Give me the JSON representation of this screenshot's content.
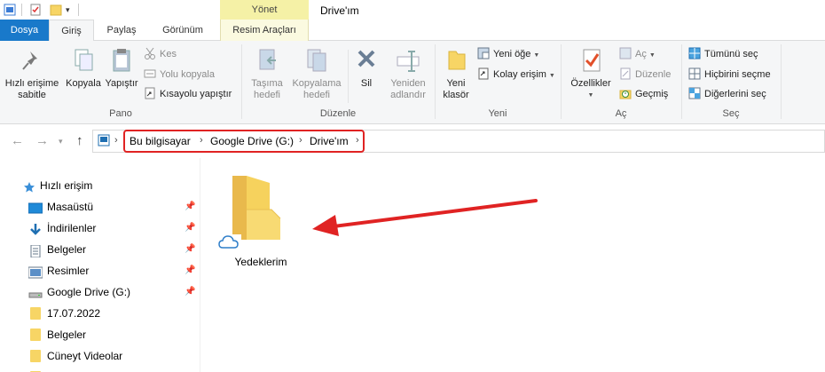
{
  "title_bar": {
    "window_title": "Drive'ım",
    "tool_tab_header": "Yönet"
  },
  "tabs": [
    {
      "label": "Dosya"
    },
    {
      "label": "Giriş"
    },
    {
      "label": "Paylaş"
    },
    {
      "label": "Görünüm"
    },
    {
      "label": "Resim Araçları"
    }
  ],
  "ribbon": {
    "pano": {
      "label": "Pano",
      "pin_quick_access": "Hızlı erişime\nsabitle",
      "copy": "Kopyala",
      "paste": "Yapıştır",
      "cut": "Kes",
      "copy_path": "Yolu kopyala",
      "paste_shortcut": "Kısayolu yapıştır"
    },
    "duzenle": {
      "label": "Düzenle",
      "move_to": "Taşıma\nhedefi",
      "copy_to": "Kopyalama\nhedefi",
      "delete": "Sil",
      "rename": "Yeniden\nadlandır"
    },
    "yeni": {
      "label": "Yeni",
      "new_folder": "Yeni\nklasör",
      "new_item": "Yeni öğe",
      "easy_access": "Kolay erişim"
    },
    "ac": {
      "label": "Aç",
      "properties": "Özellikler",
      "open": "Aç",
      "edit": "Düzenle",
      "history": "Geçmiş"
    },
    "sec": {
      "label": "Seç",
      "select_all": "Tümünü seç",
      "select_none": "Hiçbirini seçme",
      "invert": "Diğerlerini seç"
    }
  },
  "address": {
    "crumbs": [
      "Bu bilgisayar",
      "Google Drive (G:)",
      "Drive'ım"
    ],
    "highlight_color": "#e02323"
  },
  "nav_pane": {
    "items": [
      {
        "label": "Hızlı erişim",
        "icon": "star-icon",
        "pinned": false
      },
      {
        "label": "Masaüstü",
        "icon": "desktop-icon",
        "pinned": true
      },
      {
        "label": "İndirilenler",
        "icon": "download-icon",
        "pinned": true
      },
      {
        "label": "Belgeler",
        "icon": "document-icon",
        "pinned": true
      },
      {
        "label": "Resimler",
        "icon": "pictures-icon",
        "pinned": true
      },
      {
        "label": "Google Drive (G:)",
        "icon": "drive-icon",
        "pinned": true
      },
      {
        "label": "17.07.2022",
        "icon": "folder-icon",
        "pinned": false
      },
      {
        "label": "Belgeler",
        "icon": "folder-icon",
        "pinned": false
      },
      {
        "label": "Cüneyt Videolar",
        "icon": "folder-icon",
        "pinned": false
      }
    ]
  },
  "content": {
    "items": [
      {
        "name": "Yedeklerim",
        "type": "folder",
        "status": "cloud"
      }
    ],
    "annotation_arrow_color": "#e02323"
  },
  "colors": {
    "accent": "#1979ca",
    "tool_tab": "#f5f1a6",
    "folder": "#f7d565"
  }
}
